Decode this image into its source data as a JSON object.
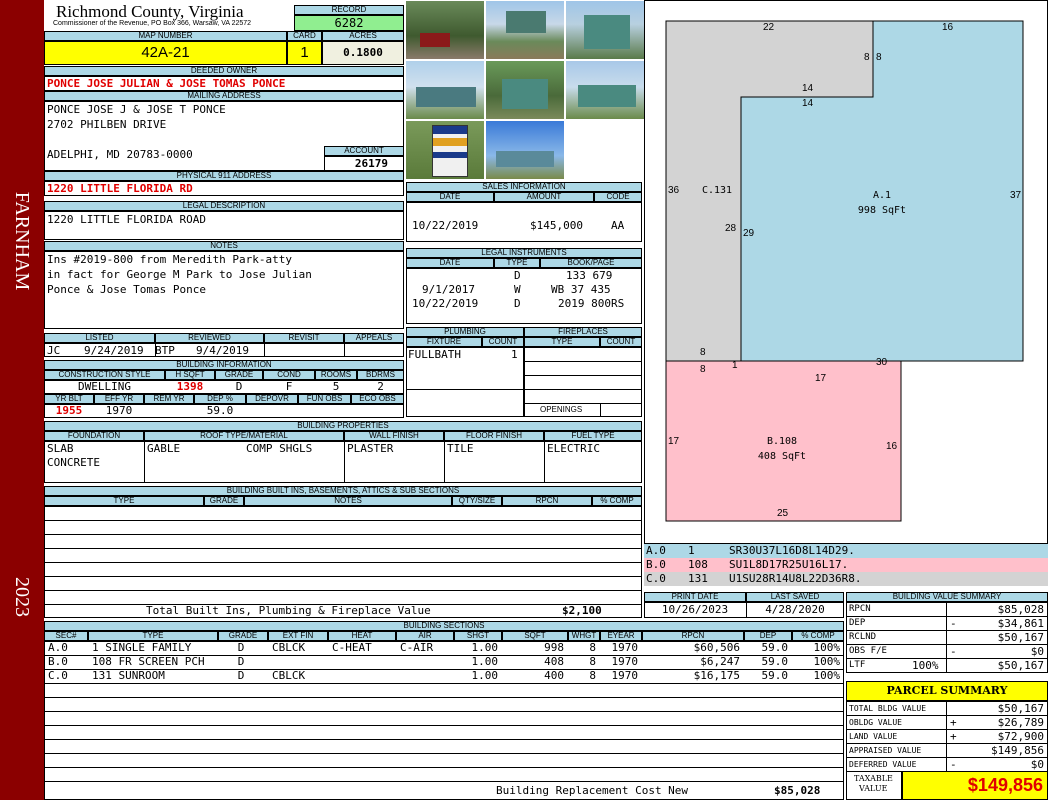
{
  "side": {
    "district": "FARNHAM",
    "year": "2023"
  },
  "county": {
    "title": "Richmond County, Virginia",
    "address": "Commissioner of the Revenue, PO Box 366, Warsaw, VA 22572"
  },
  "record": {
    "label": "RECORD",
    "value": "6282"
  },
  "map": {
    "label": "MAP NUMBER",
    "value": "42A-21"
  },
  "card": {
    "label": "CARD",
    "value": "1"
  },
  "acres": {
    "label": "ACRES",
    "value": "0.1800"
  },
  "owner": {
    "label": "DEEDED OWNER",
    "value": "PONCE JOSE JULIAN & JOSE TOMAS PONCE"
  },
  "mailing": {
    "label": "MAILING ADDRESS",
    "line1": "PONCE JOSE J & JOSE T PONCE",
    "line2": "2702 PHILBEN DRIVE",
    "line3": "ADELPHI, MD 20783-0000"
  },
  "account": {
    "label": "ACCOUNT",
    "value": "26179"
  },
  "physical": {
    "label": "PHYSICAL 911 ADDRESS",
    "value": "1220 LITTLE FLORIDA RD"
  },
  "legal": {
    "label": "LEGAL DESCRIPTION",
    "value": "1220 LITTLE FLORIDA ROAD"
  },
  "notes": {
    "label": "NOTES",
    "line1": "Ins #2019-800 from Meredith Park-atty",
    "line2": "in fact for George M Park to Jose Julian",
    "line3": "Ponce & Jose Tomas Ponce"
  },
  "review": {
    "listed_label": "LISTED",
    "reviewed_label": "REVIEWED",
    "revisit_label": "REVISIT",
    "appeals_label": "APPEALS",
    "listed_by": "JC",
    "listed_date": "9/24/2019",
    "reviewed_by": "BTP",
    "reviewed_date": "9/4/2019"
  },
  "building_info": {
    "label": "BUILDING INFORMATION",
    "h1": "CONSTRUCTION STYLE",
    "h2": "H SQFT",
    "h3": "GRADE",
    "h4": "COND",
    "h5": "ROOMS",
    "h6": "BDRMS",
    "style": "DWELLING",
    "hsqft": "1398",
    "grade": "D",
    "cond": "F",
    "rooms": "5",
    "bdrms": "2",
    "h7": "YR BLT",
    "h8": "EFF YR",
    "h9": "REM YR",
    "h10": "DEP %",
    "h11": "DEPOVR",
    "h12": "FUN OBS",
    "h13": "ECO OBS",
    "yrblt": "1955",
    "effyr": "1970",
    "dep": "59.0"
  },
  "sales": {
    "label": "SALES INFORMATION",
    "h1": "DATE",
    "h2": "AMOUNT",
    "h3": "CODE",
    "date": "10/22/2019",
    "amount": "$145,000",
    "code": "AA"
  },
  "instruments": {
    "label": "LEGAL INSTRUMENTS",
    "h1": "DATE",
    "h2": "TYPE",
    "h3": "BOOK/PAGE",
    "rows": [
      {
        "date": "",
        "type": "D",
        "book": "133 679"
      },
      {
        "date": "9/1/2017",
        "type": "W",
        "book": "WB 37 435"
      },
      {
        "date": "10/22/2019",
        "type": "D",
        "book": "2019 800RS"
      }
    ]
  },
  "plumbing": {
    "label": "PLUMBING",
    "h1": "FIXTURE",
    "h2": "COUNT",
    "fixture": "FULLBATH",
    "count": "1"
  },
  "fireplaces": {
    "label": "FIREPLACES",
    "h1": "TYPE",
    "h2": "COUNT",
    "openings": "OPENINGS"
  },
  "properties": {
    "label": "BUILDING PROPERTIES",
    "h1": "FOUNDATION",
    "h2": "ROOF TYPE/MATERIAL",
    "h3": "WALL FINISH",
    "h4": "FLOOR FINISH",
    "h5": "FUEL TYPE",
    "foundation1": "SLAB",
    "foundation2": "CONCRETE",
    "roof_type": "GABLE",
    "roof_mat": "COMP SHGLS",
    "wall": "PLASTER",
    "floor": "TILE",
    "fuel": "ELECTRIC"
  },
  "builtins": {
    "label": "BUILDING BUILT INS, BASEMENTS, ATTICS & SUB SECTIONS",
    "h1": "TYPE",
    "h2": "GRADE",
    "h3": "NOTES",
    "h4": "QTY/SIZE",
    "h5": "RPCN",
    "h6": "% COMP",
    "total_label": "Total Built Ins, Plumbing & Fireplace Value",
    "total_value": "$2,100"
  },
  "sections": {
    "label": "BUILDING SECTIONS",
    "headers": [
      "SEC#",
      "TYPE",
      "GRADE",
      "EXT FIN",
      "HEAT",
      "AIR",
      "SHGT",
      "SQFT",
      "WHGT",
      "EYEAR",
      "RPCN",
      "DEP",
      "% COMP"
    ],
    "rows": [
      {
        "sec": "A.0",
        "type": "1 SINGLE FAMILY",
        "grade": "D",
        "ext": "CBLCK",
        "heat": "C-HEAT",
        "air": "C-AIR",
        "shgt": "1.00",
        "sqft": "998",
        "whgt": "8",
        "eyear": "1970",
        "rpcn": "$60,506",
        "dep": "59.0",
        "comp": "100%"
      },
      {
        "sec": "B.0",
        "type": "108 FR SCREEN PCH",
        "grade": "D",
        "ext": "",
        "heat": "",
        "air": "",
        "shgt": "1.00",
        "sqft": "408",
        "whgt": "8",
        "eyear": "1970",
        "rpcn": "$6,247",
        "dep": "59.0",
        "comp": "100%"
      },
      {
        "sec": "C.0",
        "type": "131 SUNROOM",
        "grade": "D",
        "ext": "CBLCK",
        "heat": "",
        "air": "",
        "shgt": "1.00",
        "sqft": "400",
        "whgt": "8",
        "eyear": "1970",
        "rpcn": "$16,175",
        "dep": "59.0",
        "comp": "100%"
      }
    ],
    "brcn_label": "Building Replacement Cost New",
    "brcn_value": "$85,028"
  },
  "sketch": {
    "a_label": "A.1",
    "a_sqft": "998 SqFt",
    "b_label": "B.108",
    "b_sqft": "408 SqFt",
    "c_label": "C.131",
    "dims": {
      "d22": "22",
      "d16": "16",
      "d8a": "8",
      "d8b": "8",
      "d14a": "14",
      "d14b": "14",
      "d36": "36",
      "d37": "37",
      "d28": "28",
      "d29": "29",
      "d8c": "8",
      "d8d": "8",
      "d1": "1",
      "d30": "30",
      "d17a": "17",
      "d17b": "17",
      "d16b": "16",
      "d25": "25"
    },
    "legend": [
      {
        "id": "A.0",
        "code": "1",
        "vec": "SR30U37L16D8L14D29."
      },
      {
        "id": "B.0",
        "code": "108",
        "vec": "SU1L8D17R25U16L17."
      },
      {
        "id": "C.0",
        "code": "131",
        "vec": "U1SU28R14U8L22D36R8."
      }
    ]
  },
  "print": {
    "print_label": "PRINT DATE",
    "print_value": "10/26/2023",
    "saved_label": "LAST SAVED",
    "saved_value": "4/28/2020"
  },
  "value_summary": {
    "label": "BUILDING VALUE SUMMARY",
    "rows": [
      {
        "name": "RPCN",
        "sign": "",
        "pct": "",
        "value": "$85,028"
      },
      {
        "name": "DEP",
        "sign": "-",
        "pct": "",
        "value": "$34,861"
      },
      {
        "name": "RCLND",
        "sign": "",
        "pct": "",
        "value": "$50,167"
      },
      {
        "name": "OBS F/E",
        "sign": "-",
        "pct": "",
        "value": "$0"
      },
      {
        "name": "LTF",
        "sign": "",
        "pct": "100%",
        "value": "$50,167"
      }
    ]
  },
  "parcel": {
    "label": "PARCEL SUMMARY",
    "rows": [
      {
        "name": "TOTAL BLDG VALUE",
        "sign": "",
        "value": "$50,167"
      },
      {
        "name": "OBLDG VALUE",
        "sign": "+",
        "value": "$26,789"
      },
      {
        "name": "LAND VALUE",
        "sign": "+",
        "value": "$72,900"
      },
      {
        "name": "APPRAISED VALUE",
        "sign": "",
        "value": "$149,856"
      },
      {
        "name": "DEFERRED VALUE",
        "sign": "-",
        "value": "$0"
      }
    ],
    "taxable_label1": "TAXABLE",
    "taxable_label2": "VALUE",
    "taxable_value": "$149,856"
  },
  "colors": {
    "side_bar": "#8b0000",
    "header_blue": "#add8e6",
    "yellow": "#ffff00",
    "green": "#90ee90",
    "sketch_a": "#add8e6",
    "sketch_b": "#ffc0cb",
    "sketch_c": "#d3d3d3"
  }
}
